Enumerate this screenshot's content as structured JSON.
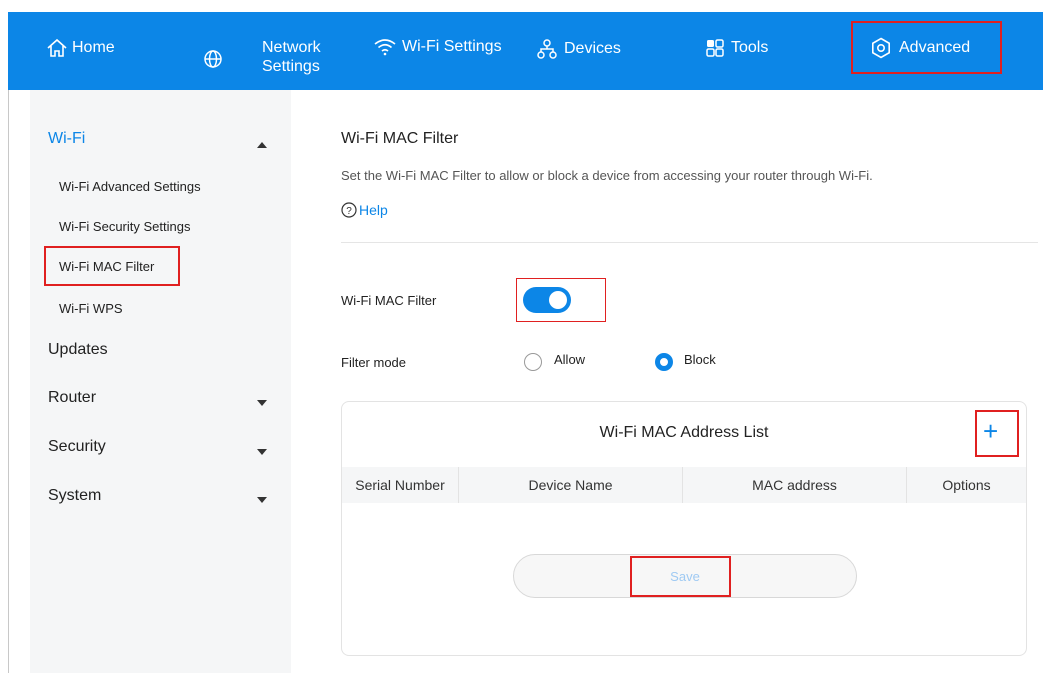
{
  "nav": {
    "home": "Home",
    "network_line1": "Network",
    "network_line2": "Settings",
    "wifi": "Wi-Fi Settings",
    "devices": "Devices",
    "tools": "Tools",
    "advanced": "Advanced"
  },
  "sidebar": {
    "wifi": "Wi-Fi",
    "wifi_sub": [
      "Wi-Fi Advanced Settings",
      "Wi-Fi Security Settings",
      "Wi-Fi MAC Filter",
      "Wi-Fi WPS"
    ],
    "updates": "Updates",
    "router": "Router",
    "security": "Security",
    "system": "System"
  },
  "main": {
    "title": "Wi-Fi MAC Filter",
    "description": "Set the Wi-Fi MAC Filter to allow or block a device from accessing your router through Wi-Fi.",
    "help": "Help",
    "mac_filter_label": "Wi-Fi MAC Filter",
    "filter_mode_label": "Filter mode",
    "allow": "Allow",
    "block": "Block",
    "list_title": "Wi-Fi MAC Address List",
    "columns": [
      "Serial Number",
      "Device Name",
      "MAC address",
      "Options"
    ],
    "save": "Save"
  },
  "colors": {
    "accent": "#0c86e7",
    "highlight": "#e02020"
  }
}
